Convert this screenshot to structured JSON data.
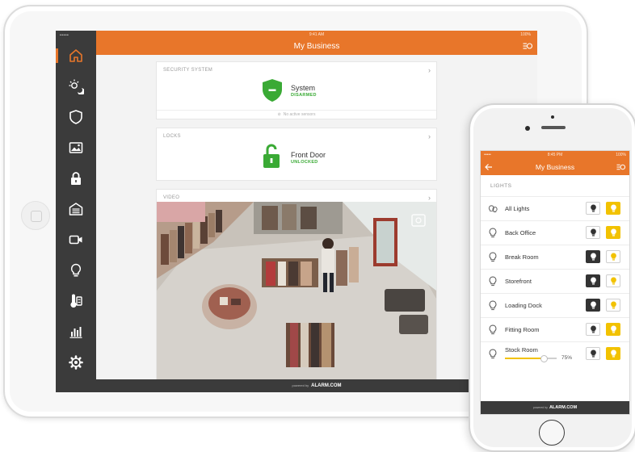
{
  "tablet": {
    "status_left": "••••• ",
    "time": "9:41 AM",
    "battery": "100%",
    "title": "My Business",
    "sidebar": [
      "home-icon",
      "sun-moon-icon",
      "shield-icon",
      "image-icon",
      "lock-icon",
      "garage-icon",
      "video-camera-icon",
      "lightbulb-icon",
      "thermostat-icon",
      "bar-chart-icon",
      "gear-icon"
    ],
    "security": {
      "label": "SECURITY SYSTEM",
      "name": "System",
      "status": "DISARMED",
      "footer": "No active sensors"
    },
    "locks": {
      "label": "LOCKS",
      "name": "Front Door",
      "status": "UNLOCKED"
    },
    "video": {
      "label": "VIDEO"
    },
    "footer": {
      "powered": "powered by",
      "brand": "ALARM.COM"
    },
    "colors": {
      "accent": "#e8762a",
      "sidebar": "#3b3b3b",
      "ok": "#3aaa35"
    }
  },
  "phone": {
    "status_left": "••••• ",
    "time": "8:45 PM",
    "battery": "100%",
    "title": "My Business",
    "section": "LIGHTS",
    "lights": [
      {
        "name": "All Lights",
        "state": "on"
      },
      {
        "name": "Back Office",
        "state": "on"
      },
      {
        "name": "Break Room",
        "state": "off"
      },
      {
        "name": "Storefront",
        "state": "off"
      },
      {
        "name": "Loading Dock",
        "state": "off"
      },
      {
        "name": "Fitting Room",
        "state": "on"
      },
      {
        "name": "Stock Room",
        "state": "on",
        "level": 75,
        "level_label": "75%"
      }
    ],
    "footer": {
      "powered": "powered by",
      "brand": "ALARM.COM"
    },
    "colors": {
      "accent": "#e8762a",
      "on": "#f2c200",
      "off": "#333333"
    }
  }
}
